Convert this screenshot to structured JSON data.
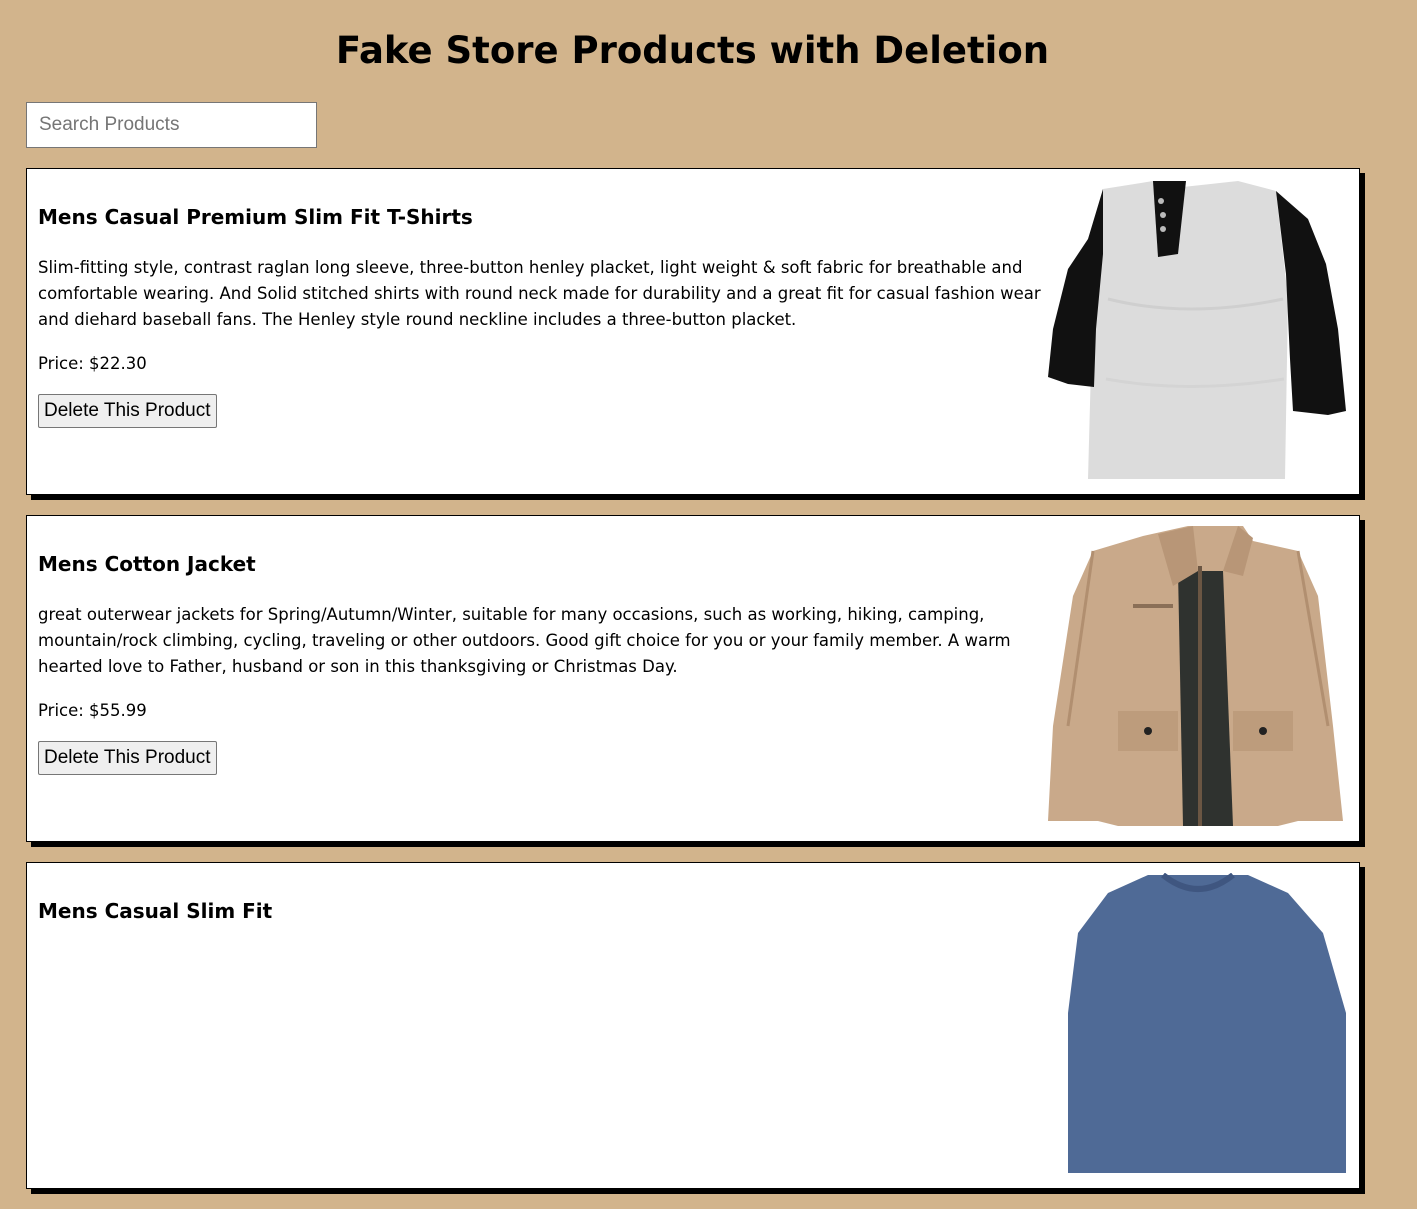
{
  "page": {
    "title": "Fake Store Products with Deletion"
  },
  "search": {
    "placeholder": "Search Products",
    "value": ""
  },
  "products": [
    {
      "title": "Mens Casual Premium Slim Fit T-Shirts",
      "description": "Slim-fitting style, contrast raglan long sleeve, three-button henley placket, light weight & soft fabric for breathable and comfortable wearing. And Solid stitched shirts with round neck made for durability and a great fit for casual fashion wear and diehard baseball fans. The Henley style round neckline includes a three-button placket.",
      "price": "Price: $22.30",
      "delete_label": "Delete This Product",
      "image_name": "raglan-tshirt-image"
    },
    {
      "title": "Mens Cotton Jacket",
      "description": "great outerwear jackets for Spring/Autumn/Winter, suitable for many occasions, such as working, hiking, camping, mountain/rock climbing, cycling, traveling or other outdoors. Good gift choice for you or your family member. A warm hearted love to Father, husband or son in this thanksgiving or Christmas Day.",
      "price": "Price: $55.99",
      "delete_label": "Delete This Product",
      "image_name": "cotton-jacket-image"
    },
    {
      "title": "Mens Casual Slim Fit",
      "description": "",
      "price": "",
      "delete_label": "",
      "image_name": "slim-fit-shirt-image"
    }
  ],
  "colors": {
    "background": "#d2b48c",
    "card": "#ffffff",
    "shadow": "#000000"
  }
}
